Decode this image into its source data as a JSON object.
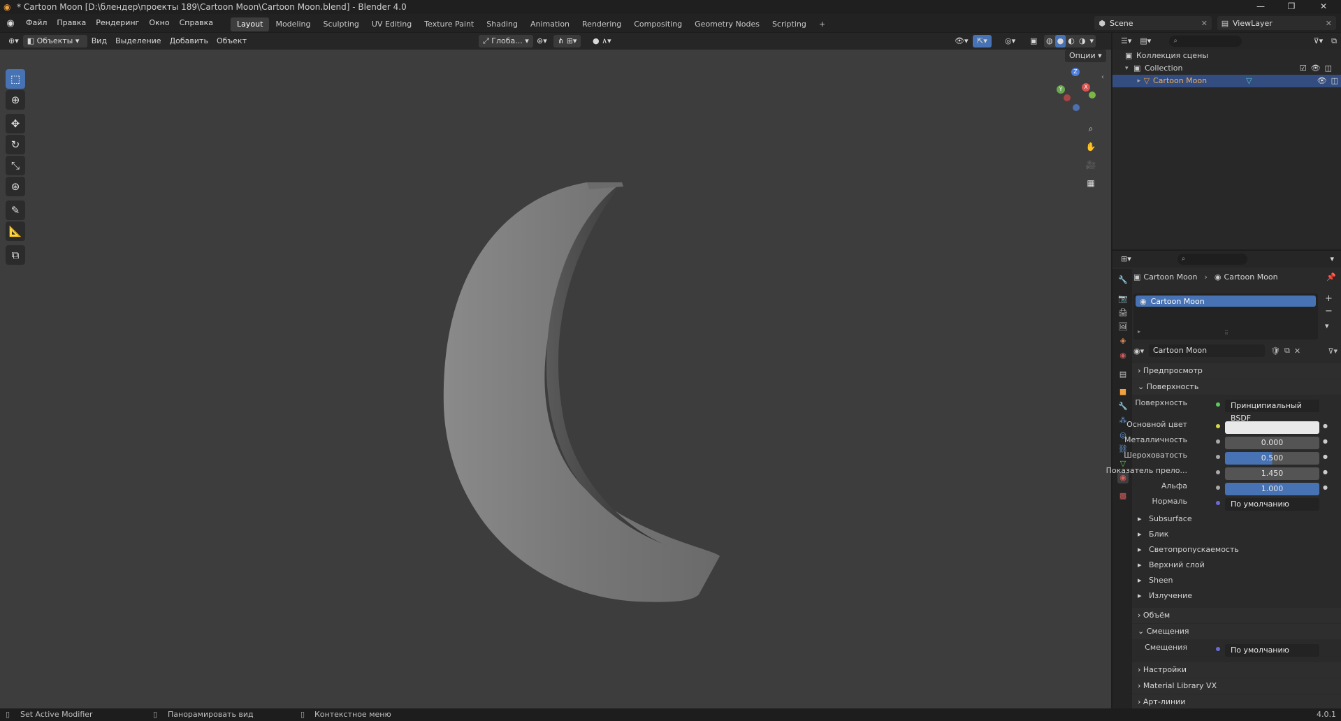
{
  "window": {
    "title": "* Cartoon Moon [D:\\блендер\\проекты 189\\Cartoon Moon\\Cartoon Moon.blend] - Blender 4.0",
    "minimize": "—",
    "maximize": "❐",
    "close": "✕"
  },
  "menu": [
    "Файл",
    "Правка",
    "Рендеринг",
    "Окно",
    "Справка"
  ],
  "workspaces": [
    "Layout",
    "Modeling",
    "Sculpting",
    "UV Editing",
    "Texture Paint",
    "Shading",
    "Animation",
    "Rendering",
    "Compositing",
    "Geometry Nodes",
    "Scripting"
  ],
  "active_workspace": "Layout",
  "add_workspace": "+",
  "scene": "Scene",
  "view_layer": "ViewLayer",
  "viewport_header": {
    "mode": "Объекты",
    "menus": [
      "Вид",
      "Выделение",
      "Добавить",
      "Объект"
    ],
    "transform_orientation": "Глоба...",
    "options": "Опции"
  },
  "gizmo": {
    "z": "Z",
    "y": "Y",
    "x": "X"
  },
  "outliner": {
    "scene_collection": "Коллекция сцены",
    "collection": "Collection",
    "object": "Cartoon Moon"
  },
  "properties": {
    "breadcrumb_object": "Cartoon Moon",
    "breadcrumb_material": "Cartoon Moon",
    "slot": "Cartoon Moon",
    "material_name": "Cartoon Moon",
    "panels": {
      "preview": "Предпросмотр",
      "surface": "Поверхность",
      "volume": "Объём",
      "displacement": "Смещения",
      "settings": "Настройки",
      "material_library": "Material Library VX",
      "line_art": "Арт-линии"
    },
    "surface_label": "Поверхность",
    "surface_value": "Принципиальный BSDF",
    "base_color_label": "Основной цвет",
    "base_color": "#e9e9e9",
    "metallic_label": "Металличность",
    "metallic": "0.000",
    "roughness_label": "Шероховатость",
    "roughness": "0.500",
    "ior_label": "Показатель прело...",
    "ior": "1.450",
    "alpha_label": "Альфа",
    "alpha": "1.000",
    "normal_label": "Нормаль",
    "normal": "По умолчанию",
    "subsections": [
      "Subsurface",
      "Блик",
      "Светопропускаемость",
      "Верхний слой",
      "Sheen",
      "Излучение"
    ],
    "displacement_label": "Смещения",
    "displacement_value": "По умолчанию"
  },
  "status": {
    "left": "Set Active Modifier",
    "mid": "Панорамировать вид",
    "right": "Контекстное меню",
    "version": "4.0.1"
  },
  "colors": {
    "accent": "#4772b3",
    "object_orange": "#f0a040"
  }
}
